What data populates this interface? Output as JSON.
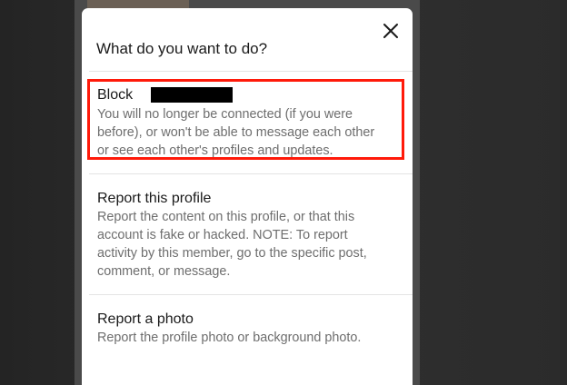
{
  "dialog": {
    "title": "What do you want to do?",
    "close_icon": "close-icon"
  },
  "options": [
    {
      "title": "Block",
      "redacted_name": true,
      "description_lines": [
        "You will no longer be connected (if you were",
        "before), or won't be able to message each other",
        "or see each other's profiles and updates."
      ],
      "highlighted": true
    },
    {
      "title": "Report this profile",
      "description_lines": [
        "Report the content on this profile, or that this",
        "account is fake or hacked. NOTE: To report",
        "activity by this member, go to the specific post,",
        "comment, or message."
      ]
    },
    {
      "title": "Report a photo",
      "description_lines": [
        "Report the profile photo or background photo."
      ]
    }
  ],
  "colors": {
    "highlight_border": "#ff1a0a",
    "dialog_background": "#ffffff",
    "backdrop": "#2a2a2a",
    "title_text": "#1a1a1a",
    "description_text": "#6e6e6e"
  }
}
